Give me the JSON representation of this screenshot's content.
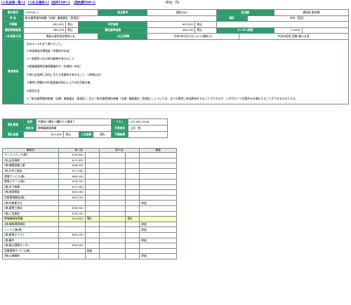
{
  "nav": {
    "links": [
      "[入札結果一覧へ]",
      "[入札日選択へ]",
      "[役所TOPへ]",
      "[契約課TOPへ]"
    ],
    "unit": "(単位：円)"
  },
  "summary": {
    "labels": {
      "case_no": "案件番号",
      "ann_no": "発注番号",
      "section": "担当課",
      "name": "件 名",
      "place": "場所",
      "est": "予算額",
      "tax1": "税込",
      "plan": "予定価格",
      "tax2": "税込",
      "mincost": "最低制限価格",
      "tax3": "税込",
      "base": "最低基準価格",
      "tax4": "税込",
      "random": "ランダム係数",
      "method": "入札契約方法",
      "date": "入札日時等",
      "notes": "備考事項"
    },
    "case_no": "110544-1",
    "ann_no": "建設SW2",
    "section": "建設部 維持課",
    "name": "掛水路等維持修繕（全域）業務委託（西地区）",
    "place": "市内（西区）",
    "est_val": "692,652",
    "plan_val": "692,652",
    "mincost_val": "486,290",
    "base_val": "484,000",
    "random_val": "1.0020",
    "method": "簡易公募型指名競争入札",
    "date_text": "令和3年6月12日 (10:15開札分)",
    "date_loc": "宇治市役所 西館4階入札室",
    "notes": [
      "次の①～⑤を全て満たすこと。",
      "①参加資格名簿登録（京都府内本店）",
      "②一般競争入札の参加資格を有すること",
      "③産業廃棄物収集運搬業許可（京都府～市若）",
      "④独力全段時に市内に主たる営業所を有すること（1時間以内）",
      "⑤異常工期間の市の監督員の指示により対応可能な者",
      "⑥経営大定",
      "※「掛水路等維持修繕（全域）業務委託（東地区）」及び「掛水路等維持修繕（全域）業務委託（西地区）」については、全ての案件に参加表明をすることができるが、いずれか一つの案件のみ落札することができるものとする。"
    ]
  },
  "winner": {
    "labels": {
      "bidder": "落札業者",
      "addr": "住所",
      "tel": "ＴＥＬ",
      "co": "会社名",
      "rep": "代表者名",
      "amount": "落札金額",
      "tax": "税込",
      "result": "入札結果",
      "miss": "不調結果"
    },
    "addr": "京都府八幡市八幡町０８番地７",
    "tel": "075-981-0348",
    "co": "岬城衛開発興業",
    "rep": "上田　智",
    "amount": "612,600",
    "result": "落札"
  },
  "results": {
    "headers": [
      "業者名",
      "第１回",
      "",
      "第２回",
      "",
      "摘要"
    ],
    "rows": [
      {
        "name": "アーバンテック(株)",
        "r1": "635,800",
        "n1": "",
        "r2": "",
        "n2": "",
        "rem": ""
      },
      {
        "name": "(有)吉田清掃",
        "r1": "671,833",
        "n1": "",
        "r2": "",
        "n2": "",
        "rem": ""
      },
      {
        "name": "(株)城陽設備工業",
        "r1": "658,930",
        "n1": "",
        "r2": "",
        "n2": "",
        "rem": ""
      },
      {
        "name": "(有)大村工務店",
        "r1": "671,000",
        "n1": "",
        "r2": "",
        "n2": "",
        "rem": ""
      },
      {
        "name": "環境サービス(株)",
        "r1": "665,000",
        "n1": "",
        "r2": "",
        "n2": "",
        "rem": ""
      },
      {
        "name": "環境テクノス(株)",
        "r1": "678,730",
        "n1": "",
        "r2": "",
        "n2": "",
        "rem": ""
      },
      {
        "name": "(株)木下商事",
        "r1": "671,000",
        "n1": "",
        "r2": "",
        "n2": "",
        "rem": ""
      },
      {
        "name": "(株)協栄開発",
        "r1": "690,000",
        "n1": "",
        "r2": "",
        "n2": "",
        "rem": ""
      },
      {
        "name": "京都環境開発(株)",
        "r1": "662,200",
        "n1": "",
        "r2": "",
        "n2": "",
        "rem": ""
      },
      {
        "name": "(株)京都衛生社",
        "r1": "",
        "n1": "",
        "r2": "",
        "n2": "",
        "rem": "辞退"
      },
      {
        "name": "(株)栗栖工務店",
        "r1": "658,900",
        "n1": "",
        "r2": "",
        "n2": "",
        "rem": ""
      },
      {
        "name": "(株)三信建設",
        "r1": "678,730",
        "n1": "",
        "r2": "",
        "n2": "",
        "rem": ""
      },
      {
        "name": "岬城衛開発興業",
        "r1": "612,600",
        "n1": "落札",
        "r2": "",
        "n2": "落札",
        "rem": "",
        "win": true
      },
      {
        "name": "(株)城陽環境開発",
        "r1": "",
        "n1": "",
        "r2": "",
        "n2": "",
        "rem": "辞退"
      },
      {
        "name": "シンジ工業(株)",
        "r1": "",
        "n1": "",
        "r2": "",
        "n2": "",
        "rem": "辞退"
      },
      {
        "name": "(株)東陽ネクスト",
        "r1": "660,000",
        "n1": "",
        "r2": "",
        "n2": "",
        "rem": ""
      },
      {
        "name": "(株)藤井",
        "r1": "",
        "n1": "",
        "r2": "",
        "n2": "",
        "rem": "辞退"
      },
      {
        "name": "(株)東山環境センター",
        "r1": "649,000",
        "n1": "",
        "r2": "",
        "n2": "",
        "rem": ""
      },
      {
        "name": "武藤環境サービス(株)",
        "r1": "",
        "n1": "辞退",
        "r2": "",
        "n2": "",
        "rem": ""
      },
      {
        "name": "(株)山城精研",
        "r1": "",
        "n1": "",
        "r2": "",
        "n2": "",
        "rem": "辞退"
      }
    ]
  }
}
